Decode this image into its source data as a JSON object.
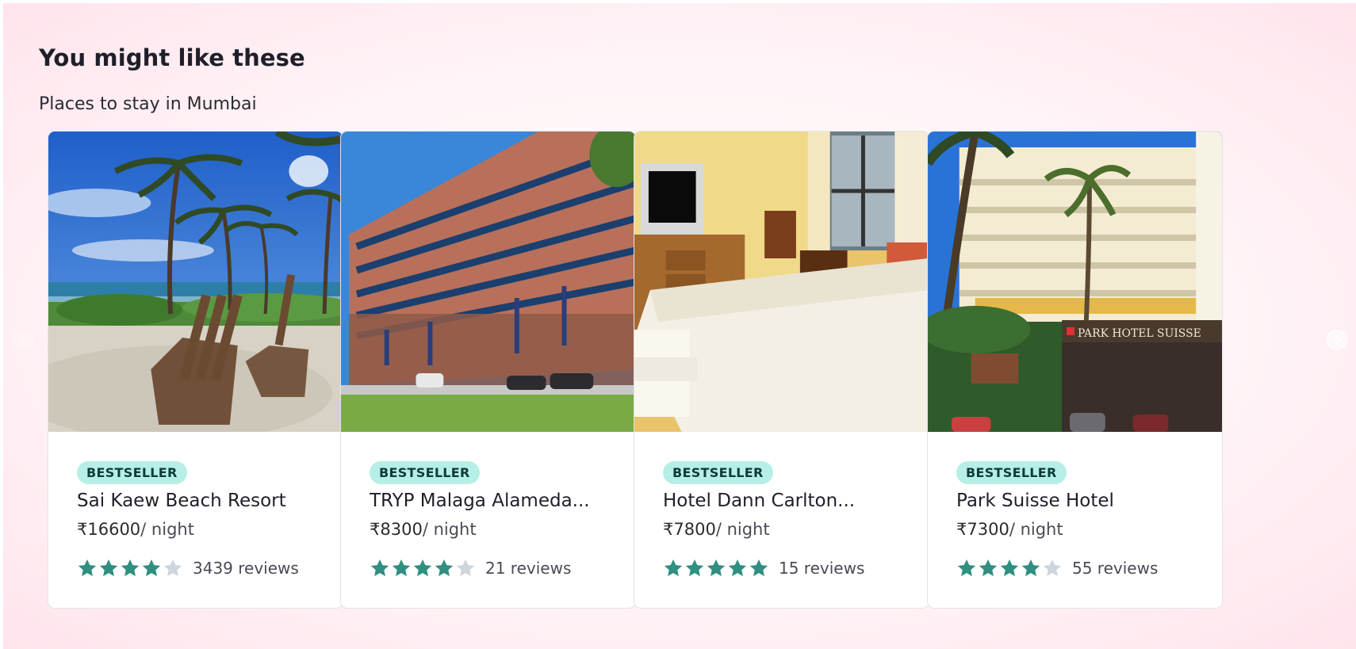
{
  "section": {
    "title": "You might like these",
    "subtitle": "Places to stay in Mumbai"
  },
  "cards": [
    {
      "badge": "BESTSELLER",
      "name": "Sai Kaew Beach Resort",
      "price": "₹16600",
      "per": "/ night",
      "rating": 4,
      "reviews": "3439 reviews",
      "photo": "beach-chairs-photo"
    },
    {
      "badge": "BESTSELLER",
      "name": "TRYP Malaga Alameda...",
      "price": "₹8300",
      "per": "/ night",
      "rating": 4,
      "reviews": "21 reviews",
      "photo": "hotel-building-photo"
    },
    {
      "badge": "BESTSELLER",
      "name": "Hotel Dann Carlton...",
      "price": "₹7800",
      "per": "/ night",
      "rating": 5,
      "reviews": "15 reviews",
      "photo": "hotel-room-photo"
    },
    {
      "badge": "BESTSELLER",
      "name": "Park Suisse Hotel",
      "price": "₹7300",
      "per": "/ night",
      "rating": 4,
      "reviews": "55 reviews",
      "photo": "hotel-facade-photo",
      "sign_text": "PARK HOTEL SUISSE"
    }
  ],
  "colors": {
    "star_filled": "#2f8f80",
    "star_empty": "#ccd6dc",
    "badge_bg": "#b5efe5",
    "background": "#ffe4ec"
  },
  "icons": {
    "prev": "chevron-left-icon",
    "next": "chevron-right-icon",
    "star": "star-icon"
  }
}
